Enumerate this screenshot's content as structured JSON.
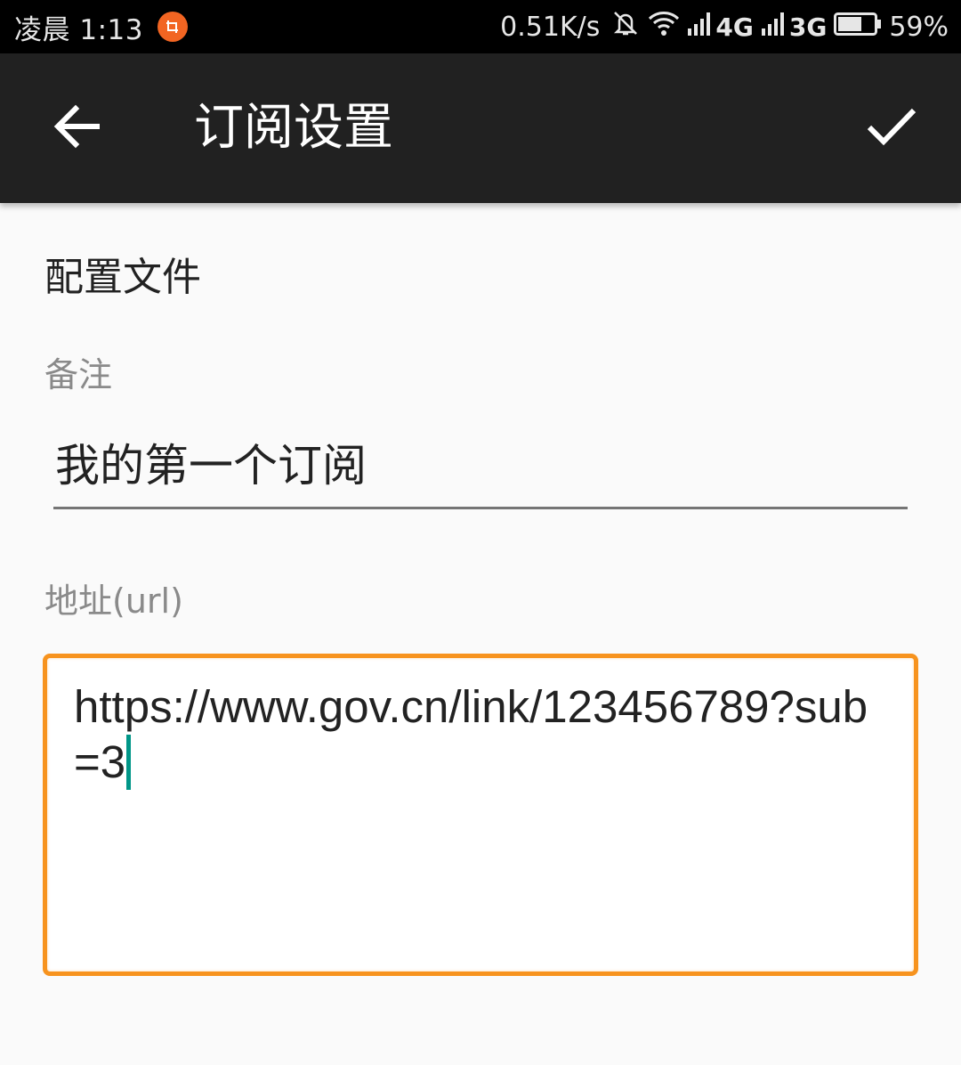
{
  "status_bar": {
    "time": "凌晨 1:13",
    "net_speed": "0.51K/s",
    "signal_1": "4G",
    "signal_2": "3G",
    "battery": "59%",
    "notif_color": "#f26522"
  },
  "app_bar": {
    "back_icon": "arrow-left-icon",
    "title": "订阅设置",
    "confirm_icon": "check-icon"
  },
  "form": {
    "section_title": "配置文件",
    "note_label": "备注",
    "note_value": "我的第一个订阅",
    "url_label": "地址(url)",
    "url_value": "https://www.gov.cn/link/123456789?sub=3",
    "focus_color": "#f7931e",
    "caret_color": "#009688"
  }
}
